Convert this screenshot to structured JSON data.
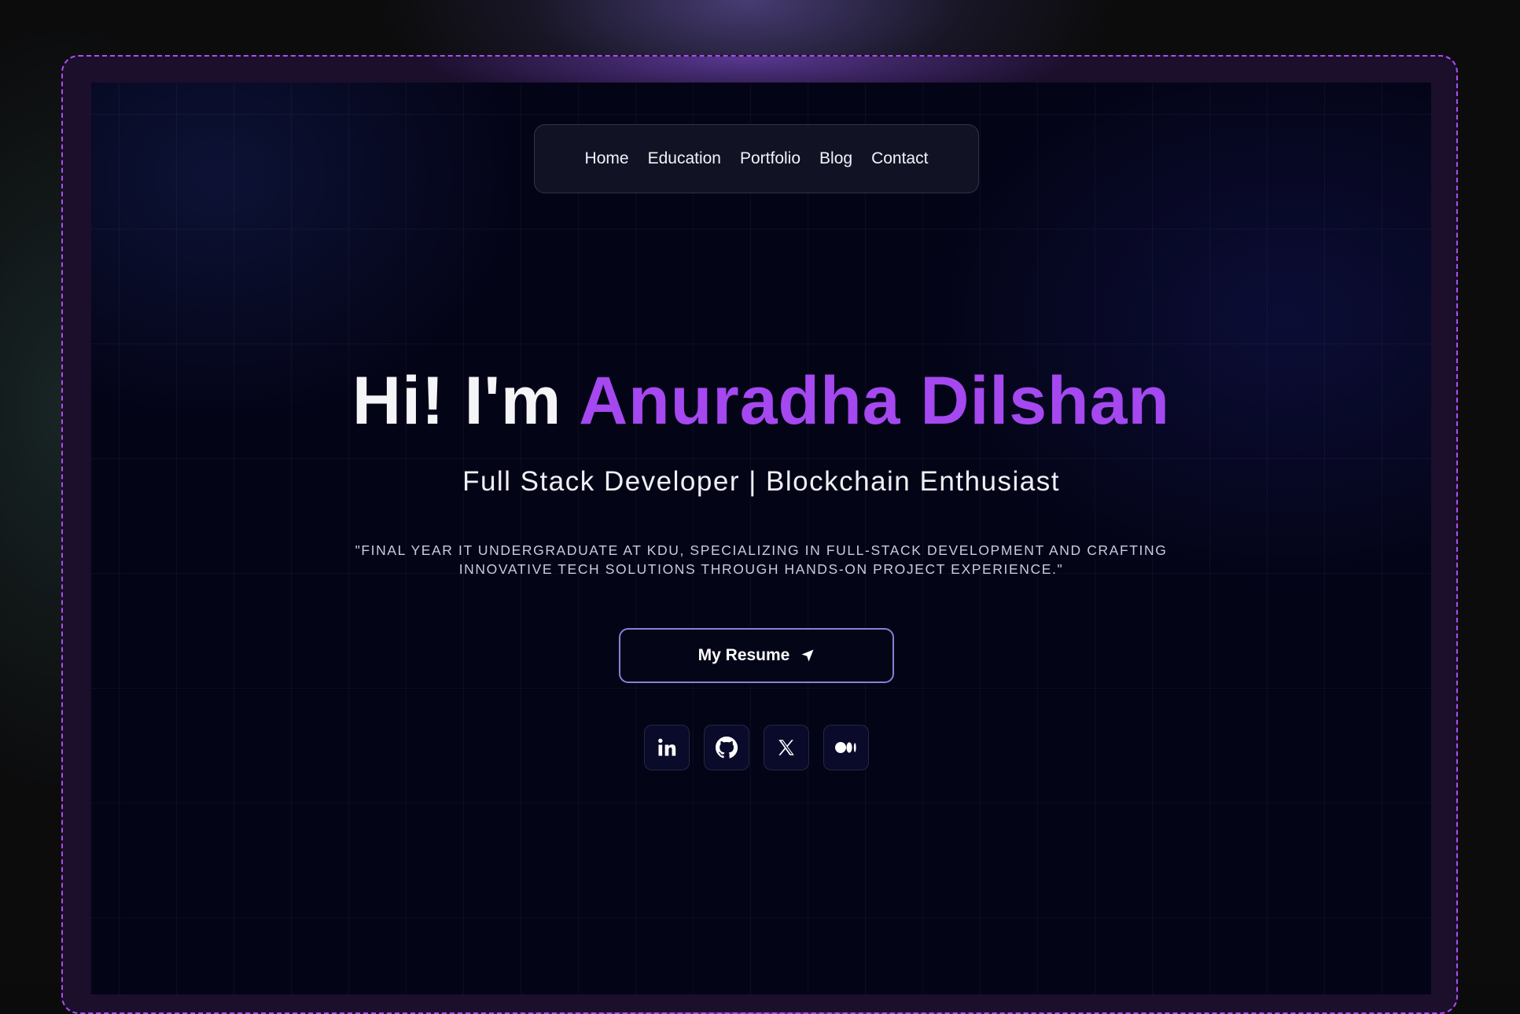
{
  "nav": {
    "items": [
      {
        "label": "Home"
      },
      {
        "label": "Education"
      },
      {
        "label": "Portfolio"
      },
      {
        "label": "Blog"
      },
      {
        "label": "Contact"
      }
    ]
  },
  "hero": {
    "greeting": "Hi! I'm ",
    "name": "Anuradha Dilshan",
    "subtitle": "Full Stack Developer | Blockchain Enthusiast",
    "quote": "\"FINAL YEAR IT UNDERGRADUATE AT KDU, SPECIALIZING IN FULL-STACK DEVELOPMENT AND CRAFTING INNOVATIVE TECH SOLUTIONS THROUGH HANDS-ON PROJECT EXPERIENCE.\"",
    "resume_button": {
      "label": "My Resume",
      "icon": "send-arrow-icon"
    }
  },
  "socials": [
    {
      "icon": "linkedin-icon"
    },
    {
      "icon": "github-icon"
    },
    {
      "icon": "x-icon"
    },
    {
      "icon": "medium-icon"
    }
  ],
  "colors": {
    "accent": "#a548f0",
    "frame_border": "#b14cf0",
    "background": "#040417",
    "button_border": "#8b7fd8"
  }
}
